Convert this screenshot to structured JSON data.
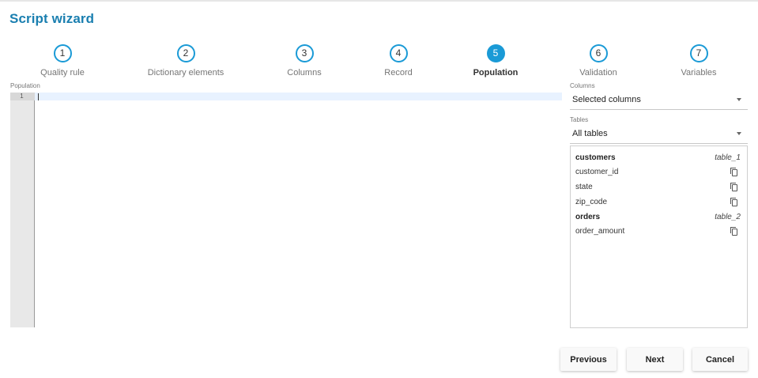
{
  "title": "Script wizard",
  "accent": "#1a9ad6",
  "steps": [
    {
      "num": "1",
      "label": "Quality rule"
    },
    {
      "num": "2",
      "label": "Dictionary elements"
    },
    {
      "num": "3",
      "label": "Columns"
    },
    {
      "num": "4",
      "label": "Record"
    },
    {
      "num": "5",
      "label": "Population",
      "active": true
    },
    {
      "num": "6",
      "label": "Validation"
    },
    {
      "num": "7",
      "label": "Variables"
    }
  ],
  "editor": {
    "label": "Population",
    "line_number": "1"
  },
  "columns": {
    "label": "Columns",
    "value": "Selected columns"
  },
  "tables": {
    "label": "Tables",
    "value": "All tables",
    "groups": [
      {
        "name": "customers",
        "alias": "table_1",
        "columns": [
          "customer_id",
          "state",
          "zip_code"
        ]
      },
      {
        "name": "orders",
        "alias": "table_2",
        "columns": [
          "order_amount"
        ]
      }
    ]
  },
  "buttons": {
    "previous": "Previous",
    "next": "Next",
    "cancel": "Cancel"
  }
}
